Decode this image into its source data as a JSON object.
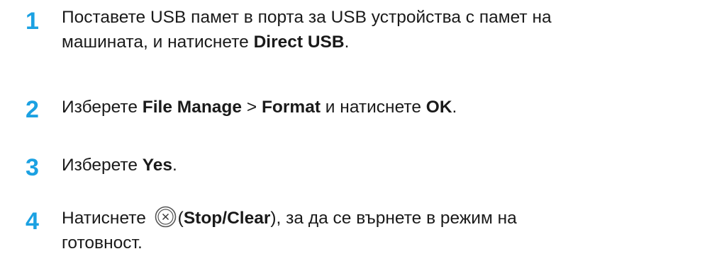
{
  "steps": [
    {
      "number": "1",
      "line1": "Поставете USB памет в порта за USB устройства с памет на",
      "line2_prefix": "машината, и натиснете ",
      "line2_bold": "Direct USB",
      "line2_suffix": "."
    },
    {
      "number": "2",
      "prefix": "Изберете ",
      "bold1": "File Manage",
      "sep": " > ",
      "bold2": "Format",
      "mid": " и натиснете ",
      "bold3": "OK",
      "suffix": "."
    },
    {
      "number": "3",
      "prefix": "Изберете ",
      "bold": "Yes",
      "suffix": "."
    },
    {
      "number": "4",
      "prefix": "Натиснете ",
      "icon": "stop-clear-icon",
      "paren_open": "(",
      "bold": "Stop/Clear",
      "paren_close": ")",
      "suffix_line1": ", за да се върнете в режим на",
      "line2": "готовност."
    }
  ],
  "colors": {
    "step_number": "#1ba1e2",
    "text": "#1a1a1a"
  }
}
